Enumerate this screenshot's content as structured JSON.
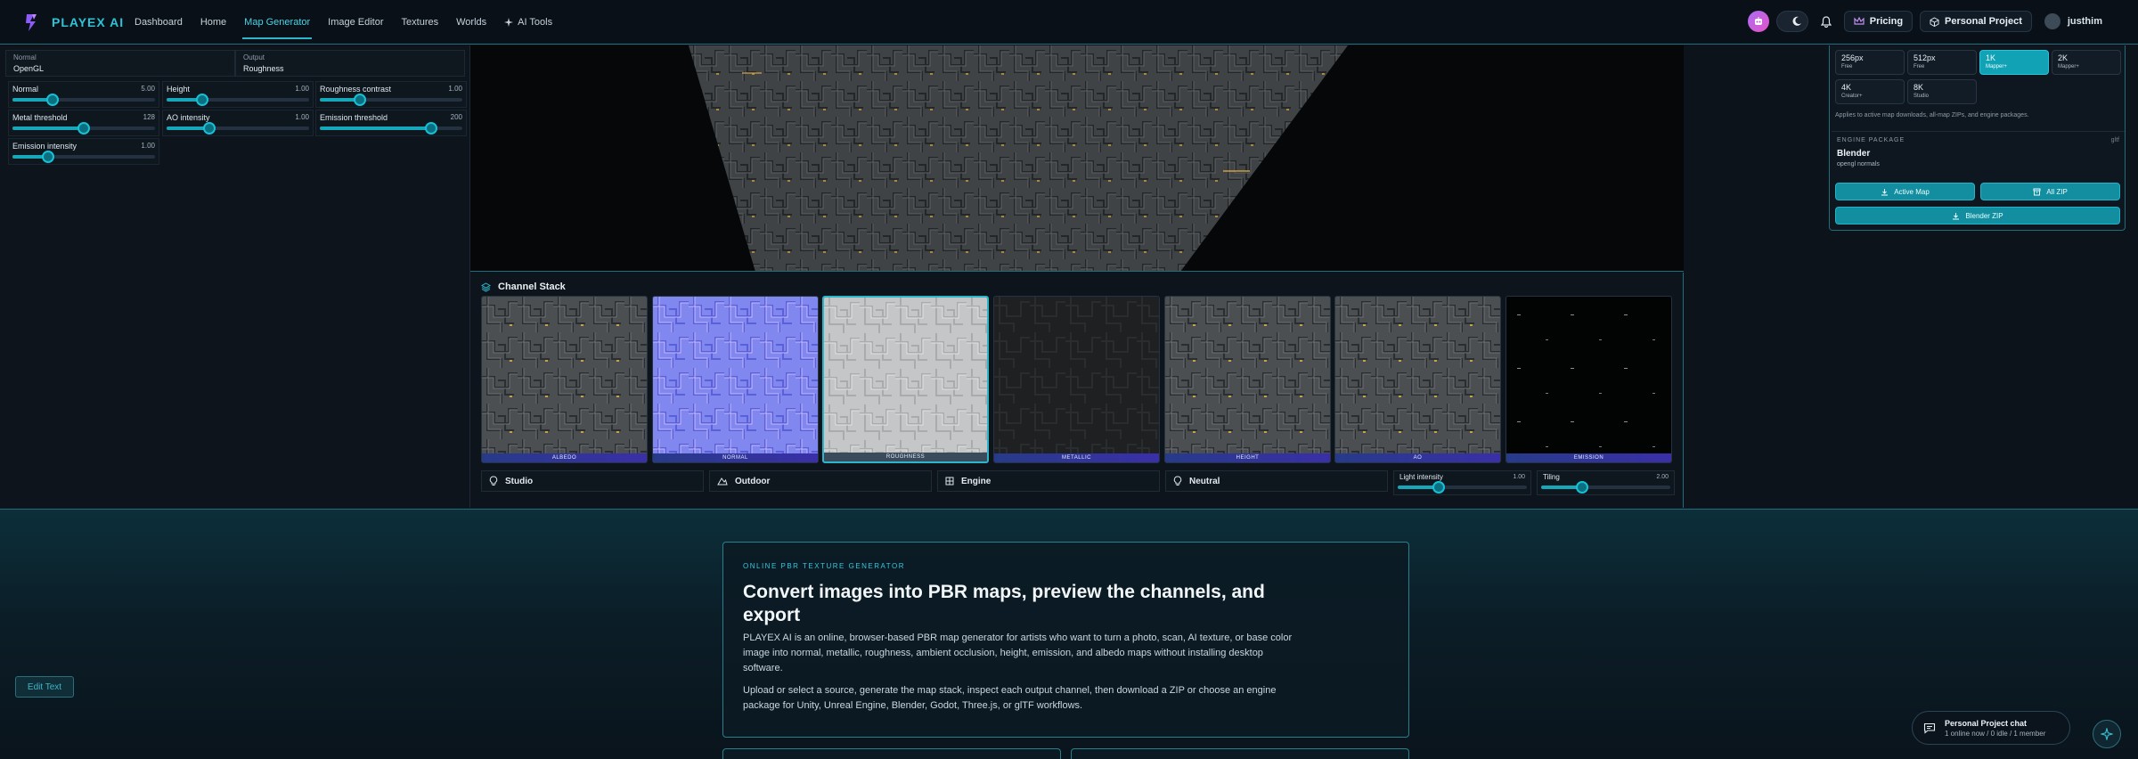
{
  "brand": {
    "name": "PLAYEX AI"
  },
  "nav": {
    "links": [
      {
        "label": "Dashboard"
      },
      {
        "label": "Home"
      },
      {
        "label": "Map Generator"
      },
      {
        "label": "Image Editor"
      },
      {
        "label": "Textures"
      },
      {
        "label": "Worlds"
      },
      {
        "label": "AI Tools"
      }
    ],
    "pricing": "Pricing",
    "project": "Personal Project",
    "user": "justhim"
  },
  "settings": {
    "normal_select": {
      "label": "Normal",
      "value": "OpenGL"
    },
    "output_select": {
      "label": "Output",
      "value": "Roughness"
    },
    "sliders": [
      {
        "label": "Normal",
        "value": "5.00",
        "level": 0.28
      },
      {
        "label": "Height",
        "value": "1.00",
        "level": 0.25
      },
      {
        "label": "Roughness contrast",
        "value": "1.00",
        "level": 0.28
      },
      {
        "label": "Metal threshold",
        "value": "128",
        "level": 0.5
      },
      {
        "label": "AO intensity",
        "value": "1.00",
        "level": 0.3
      },
      {
        "label": "Emission threshold",
        "value": "200",
        "level": 0.78
      },
      {
        "label": "Emission intensity",
        "value": "1.00",
        "level": 0.25
      }
    ]
  },
  "channel_stack": {
    "title": "Channel Stack",
    "channels": [
      {
        "label": "ALBEDO",
        "tex": "albedo"
      },
      {
        "label": "NORMAL",
        "tex": "normal"
      },
      {
        "label": "ROUGHNESS",
        "tex": "roughness",
        "selected": true
      },
      {
        "label": "METALLIC",
        "tex": "metallic"
      },
      {
        "label": "HEIGHT",
        "tex": "height"
      },
      {
        "label": "AO",
        "tex": "ao"
      },
      {
        "label": "EMISSION",
        "tex": "emission"
      }
    ],
    "lighting": [
      {
        "label": "Studio",
        "icon": "bulb-icon"
      },
      {
        "label": "Outdoor",
        "icon": "mountain-icon"
      },
      {
        "label": "Engine",
        "icon": "grid-icon"
      },
      {
        "label": "Neutral",
        "icon": "bulb-icon"
      }
    ],
    "light_intensity": {
      "label": "Light intensity",
      "value": "1.00",
      "level": 0.32
    },
    "tiling": {
      "label": "Tiling",
      "value": "2.00",
      "level": 0.32
    }
  },
  "export": {
    "resolutions": [
      {
        "title": "256px",
        "sub": "Free"
      },
      {
        "title": "512px",
        "sub": "Free"
      },
      {
        "title": "1K",
        "sub": "Mapper+",
        "active": true
      },
      {
        "title": "2K",
        "sub": "Mapper+"
      },
      {
        "title": "4K",
        "sub": "Creator+"
      },
      {
        "title": "8K",
        "sub": "Studio"
      }
    ],
    "note": "Applies to active map downloads, all-map ZIPs, and engine packages.",
    "engine": {
      "heading": "ENGINE PACKAGE",
      "ext": "gltf",
      "name": "Blender",
      "sub": "opengl normals"
    },
    "buttons": {
      "active_map": "Active Map",
      "all_zip": "All ZIP",
      "blender_zip": "Blender ZIP"
    }
  },
  "hero": {
    "eyebrow": "ONLINE PBR TEXTURE GENERATOR",
    "title": "Convert images into PBR maps, preview the channels, and export",
    "p1": "PLAYEX AI is an online, browser-based PBR map generator for artists who want to turn a photo, scan, AI texture, or base color image into normal, metallic, roughness, ambient occlusion, height, emission, and albedo maps without installing desktop software.",
    "p2": "Upload or select a source, generate the map stack, inspect each output channel, then download a ZIP or choose an engine package for Unity, Unreal Engine, Blender, Godot, Three.js, or glTF workflows."
  },
  "edit_text": "Edit Text",
  "chat": {
    "title": "Personal Project chat",
    "status": "1 online now / 0 idle / 1 member"
  },
  "colors": {
    "accent": "#2bb8cc",
    "background": "#0c131b",
    "brand": "#2ec4d8"
  }
}
